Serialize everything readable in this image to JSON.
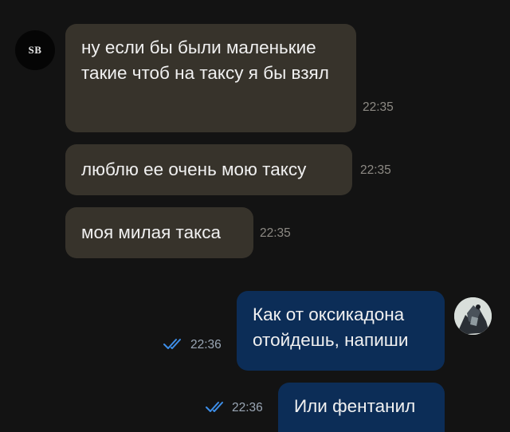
{
  "chat": {
    "incoming_avatar_initials": "SB",
    "messages": [
      {
        "direction": "in",
        "text": "ну если бы были маленькие такие чтоб на таксу я бы взял",
        "time": "22:35"
      },
      {
        "direction": "in",
        "text": "люблю ее очень мою таксу",
        "time": "22:35"
      },
      {
        "direction": "in",
        "text": "моя милая такса",
        "time": "22:35"
      },
      {
        "direction": "out",
        "text": "Как от оксикадона отойдешь, напиши",
        "time": "22:36",
        "status": "read"
      },
      {
        "direction": "out",
        "text": "Или фентанил",
        "time": "22:36",
        "status": "read"
      }
    ]
  },
  "icons": {
    "read_receipt": "double-check-icon",
    "outgoing_avatar": "user-photo-avatar"
  },
  "colors": {
    "background": "#131313",
    "incoming_bubble": "#37332b",
    "outgoing_bubble": "#0c2d57",
    "read_check": "#3d8ee8"
  }
}
